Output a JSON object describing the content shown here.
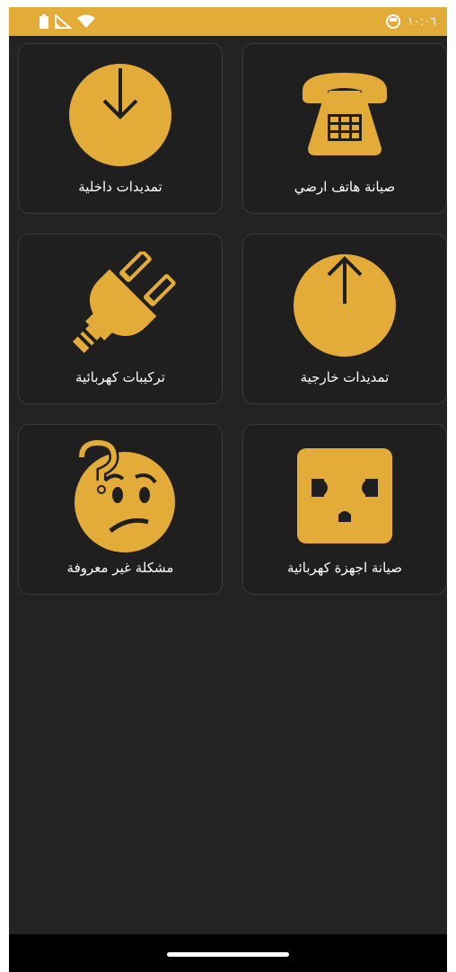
{
  "status_bar": {
    "time": "١٠:٠٦",
    "accent_color": "#e3ac38"
  },
  "services": [
    {
      "label": "صيانة هاتف ارضي",
      "icon": "telephone-icon"
    },
    {
      "label": "تمديدات داخلية",
      "icon": "arrow-down-circle-icon"
    },
    {
      "label": "تمديدات خارجية",
      "icon": "arrow-up-circle-icon"
    },
    {
      "label": "تركيبات كهربائية",
      "icon": "electric-plug-icon"
    },
    {
      "label": "صيانة اجهزة كهربائية",
      "icon": "power-outlet-icon"
    },
    {
      "label": "مشكلة غير معروفة",
      "icon": "confused-face-icon"
    }
  ],
  "colors": {
    "background": "#232323",
    "card": "#1f1f1f",
    "icon": "#e3ac38",
    "text": "#ffffff"
  }
}
